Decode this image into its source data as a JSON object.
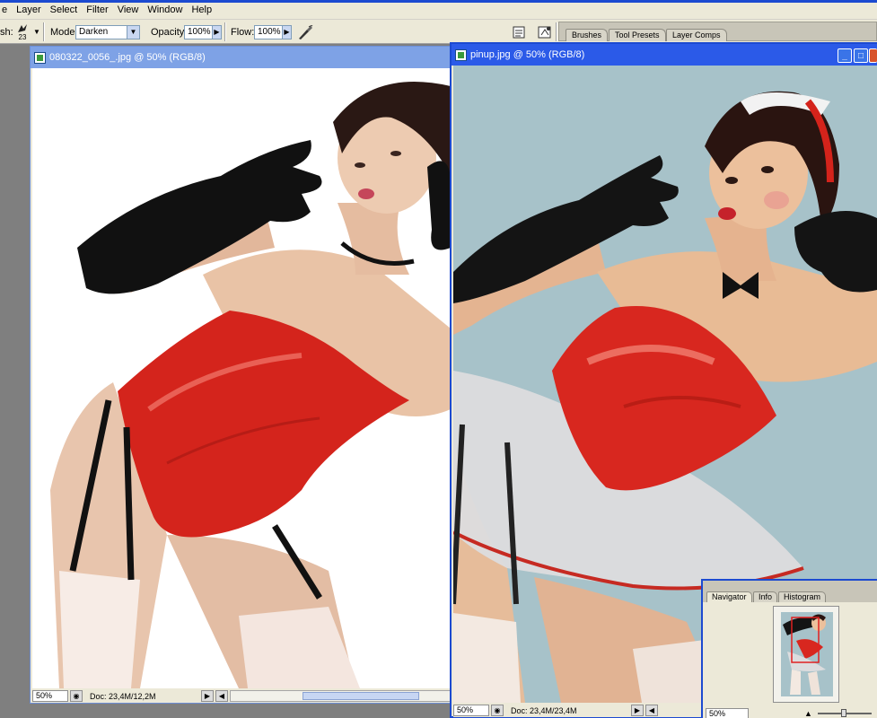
{
  "menu": {
    "items": [
      "e",
      "Layer",
      "Select",
      "Filter",
      "View",
      "Window",
      "Help"
    ]
  },
  "options": {
    "brush_label": "sh:",
    "brush_size": "23",
    "mode_label": "Mode:",
    "mode_value": "Darken",
    "opacity_label": "Opacity:",
    "opacity_value": "100%",
    "flow_label": "Flow:",
    "flow_value": "100%"
  },
  "panel_tabs": [
    "Brushes",
    "Tool Presets",
    "Layer Comps"
  ],
  "doc_left": {
    "title": "080322_0056_.jpg @ 50% (RGB/8)",
    "zoom": "50%",
    "doc_info": "Doc: 23,4M/12,2M"
  },
  "doc_right": {
    "title": "pinup.jpg @ 50% (RGB/8)",
    "zoom": "50%",
    "doc_info": "Doc: 23,4M/23,4M"
  },
  "navigator": {
    "tabs": [
      "Navigator",
      "Info",
      "Histogram"
    ],
    "zoom": "50%"
  },
  "colors": {
    "accent": "#1c4ad0",
    "titlebar": "#2b5ae8",
    "canvas_bg_right": "#a7c2c9",
    "corset_red": "#d4241c"
  }
}
